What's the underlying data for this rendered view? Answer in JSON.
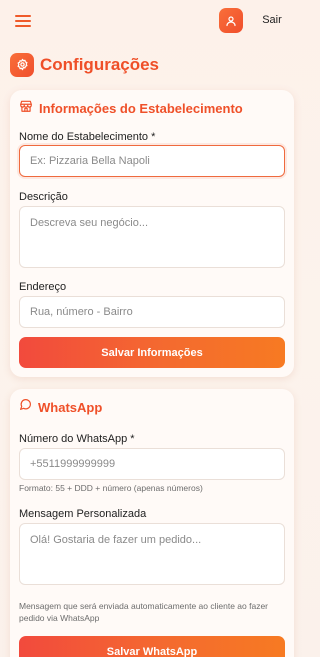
{
  "header": {
    "logout_label": "Sair"
  },
  "page": {
    "title": "Configurações"
  },
  "establishment": {
    "title": "Informações do Estabelecimento",
    "name_label": "Nome do Estabelecimento *",
    "name_placeholder": "Ex: Pizzaria Bella Napoli",
    "description_label": "Descrição",
    "description_placeholder": "Descreva seu negócio...",
    "address_label": "Endereço",
    "address_placeholder": "Rua, número - Bairro",
    "save_label": "Salvar Informações"
  },
  "whatsapp": {
    "title": "WhatsApp",
    "number_label": "Número do WhatsApp *",
    "number_placeholder": "+5511999999999",
    "number_hint": "Formato: 55 + DDD + número (apenas números)",
    "message_label": "Mensagem Personalizada",
    "message_placeholder": "Olá! Gostaria de fazer um pedido...",
    "message_hint": "Mensagem que será enviada automaticamente ao cliente ao fazer pedido via WhatsApp",
    "save_label": "Salvar WhatsApp"
  },
  "icons": {
    "menu": "menu-icon",
    "user": "user-icon",
    "settings": "settings-icon",
    "store": "store-icon",
    "chat": "message-circle-icon"
  },
  "colors": {
    "accent": "#ef5029",
    "gradient_start": "#f24a3d",
    "gradient_end": "#f77a22",
    "background": "#fdf1ea"
  }
}
